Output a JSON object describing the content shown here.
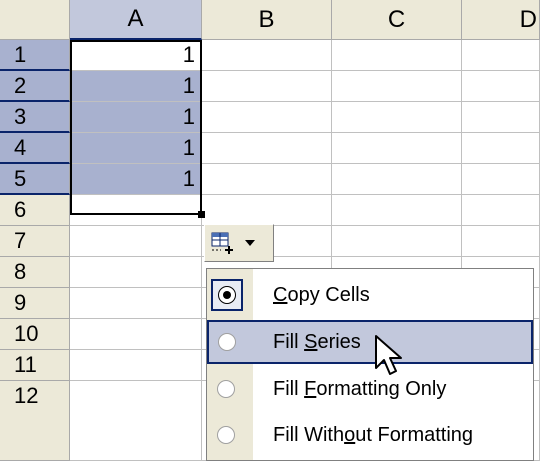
{
  "columns": [
    "A",
    "B",
    "C",
    "D"
  ],
  "rows": [
    "1",
    "2",
    "3",
    "4",
    "5",
    "6",
    "7",
    "8",
    "9",
    "10",
    "11",
    "12"
  ],
  "cells": {
    "A1": "1",
    "A2": "1",
    "A3": "1",
    "A4": "1",
    "A5": "1"
  },
  "autofill_menu": {
    "items": [
      {
        "label_pre": "",
        "label_key": "C",
        "label_post": "opy Cells",
        "checked": true
      },
      {
        "label_pre": "Fill ",
        "label_key": "S",
        "label_post": "eries",
        "checked": false
      },
      {
        "label_pre": "Fill ",
        "label_key": "F",
        "label_post": "ormatting Only",
        "checked": false
      },
      {
        "label_pre": "Fill With",
        "label_key": "o",
        "label_post": "ut Formatting",
        "checked": false
      }
    ]
  },
  "colors": {
    "selection": "#a8b1cf",
    "highlight_border": "#0a246a",
    "header_bg": "#ece9d8"
  }
}
